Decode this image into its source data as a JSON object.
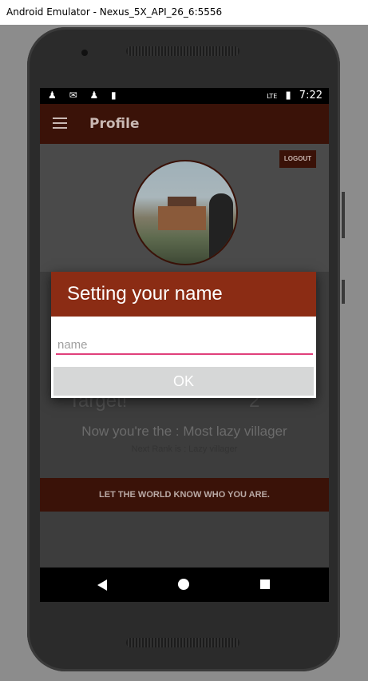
{
  "window": {
    "title": "Android Emulator - Nexus_5X_API_26_6:5556"
  },
  "statusbar": {
    "icons_left": "♟ ✉ ♟ ▮",
    "network": "LTE",
    "battery_icon": "battery-charging-icon",
    "time": "7:22"
  },
  "appbar": {
    "title": "Profile"
  },
  "profile": {
    "logout_label": "LOGOUT",
    "target_label": "Target!",
    "target_value": "2",
    "rank_text": "Now you're the : Most lazy villager",
    "next_rank_text": "Next Rank is : Lazy villager",
    "banner_label": "LET THE WORLD KNOW WHO YOU ARE."
  },
  "dialog": {
    "title": "Setting your name",
    "input_placeholder": "name",
    "input_value": "",
    "ok_label": "OK"
  },
  "colors": {
    "primary_dark": "#3a1208",
    "dialog_header": "#8b2c14",
    "input_accent": "#e0407b",
    "button_bg": "#d6d7d7"
  }
}
